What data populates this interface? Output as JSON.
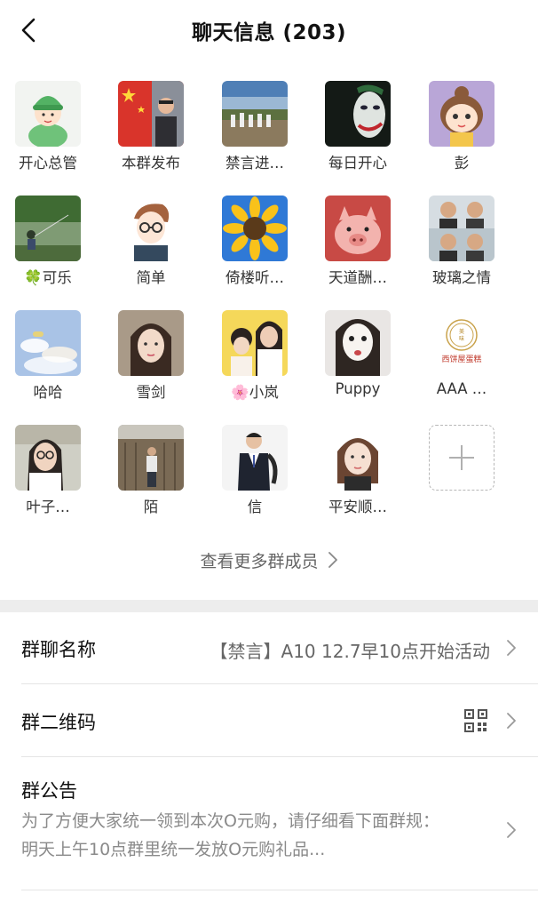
{
  "header": {
    "title": "聊天信息 (203)",
    "back_icon": "back-arrow-icon"
  },
  "members": [
    {
      "name": "开心总管",
      "avatar": "cartoon-boy-green-hat"
    },
    {
      "name": "本群发布",
      "avatar": "man-with-red-flag"
    },
    {
      "name": "禁言进…",
      "avatar": "group-photo-outdoor"
    },
    {
      "name": "每日开心",
      "avatar": "joker-face"
    },
    {
      "name": "彭",
      "avatar": "cartoon-girl"
    },
    {
      "name": "🍀可乐",
      "avatar": "fishing-pond"
    },
    {
      "name": "简单",
      "avatar": "cartoon-boy-glasses"
    },
    {
      "name": "倚楼听…",
      "avatar": "sunflower"
    },
    {
      "name": "天道酬…",
      "avatar": "pig-toy"
    },
    {
      "name": "玻璃之情",
      "avatar": "two-young-men"
    },
    {
      "name": "哈哈",
      "avatar": "blue-sky-clouds"
    },
    {
      "name": "雪剑",
      "avatar": "woman-portrait"
    },
    {
      "name": "🌸小岚",
      "avatar": "mother-and-child"
    },
    {
      "name": "Puppy",
      "avatar": "face-mask-woman"
    },
    {
      "name": "AAA …",
      "avatar": "cake-shop-logo",
      "logo_text": "西饼屋蛋糕"
    },
    {
      "name": "叶子…",
      "avatar": "woman-with-glasses"
    },
    {
      "name": "陌",
      "avatar": "man-on-cliff"
    },
    {
      "name": "信",
      "avatar": "man-in-suit"
    },
    {
      "name": "平安顺…",
      "avatar": "girl-id-photo"
    }
  ],
  "add_member": {
    "icon": "plus-icon"
  },
  "more_link": {
    "label": "查看更多群成员"
  },
  "settings": {
    "group_name": {
      "label": "群聊名称",
      "value": "【禁言】A10 12.7早10点开始活动"
    },
    "qr_code": {
      "label": "群二维码",
      "icon": "qr-code-icon"
    },
    "notice": {
      "label": "群公告",
      "line1": "为了方便大家统一领到本次O元购，请仔细看下面群规：",
      "line2": "明天上午10点群里统一发放O元购礼品..."
    }
  },
  "colors": {
    "separator": "#ededed",
    "muted_text": "#8a8a8a",
    "divider": "#e5e5e5"
  }
}
